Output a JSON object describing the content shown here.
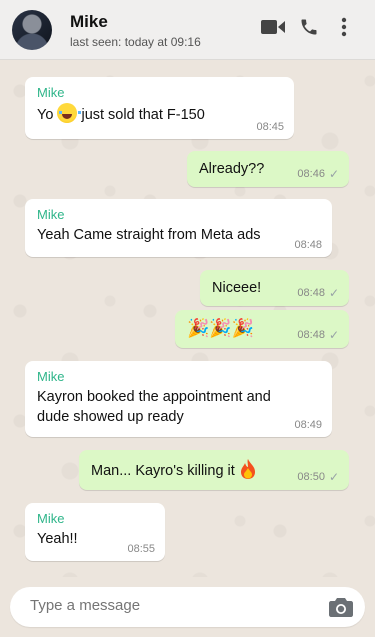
{
  "header": {
    "contact_name": "Mike",
    "status": "last seen: today at 09:16",
    "icons": [
      "video-call-icon",
      "phone-icon",
      "more-options-icon"
    ]
  },
  "messages": [
    {
      "direction": "in",
      "sender": "Mike",
      "text_before": "Yo",
      "emoji": "joy",
      "text_after": "just sold that F-150",
      "time": "08:45"
    },
    {
      "direction": "out",
      "text": "Already??",
      "time": "08:46",
      "status": "read"
    },
    {
      "direction": "in",
      "sender": "Mike",
      "text": "Yeah Came straight from Meta ads",
      "time": "08:48"
    },
    {
      "direction": "out",
      "text": "Niceee!",
      "time": "08:48",
      "status": "read"
    },
    {
      "direction": "out",
      "text": "🎉🎉🎉",
      "time": "08:48",
      "status": "read"
    },
    {
      "direction": "in",
      "sender": "Mike",
      "text": "Kayron booked the appointment and dude showed up ready",
      "time": "08:49"
    },
    {
      "direction": "out",
      "text": "Man... Kayro's killing it",
      "emoji": "fire",
      "time": "08:50",
      "status": "read"
    },
    {
      "direction": "in",
      "sender": "Mike",
      "text": "Yeah!!",
      "time": "08:55"
    }
  ],
  "composer": {
    "placeholder": "Type a message",
    "camera_icon": "camera-icon"
  },
  "colors": {
    "incoming_bubble": "#ffffff",
    "outgoing_bubble": "#dcf8c6",
    "sender_name": "#2fb58a",
    "chat_background": "#ece5dd",
    "header_background": "#f0efee"
  }
}
